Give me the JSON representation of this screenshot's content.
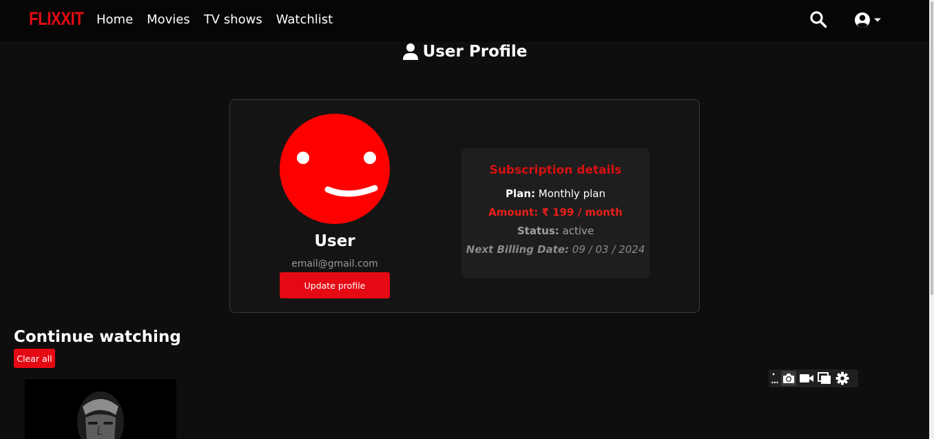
{
  "brand": {
    "name": "FLIXXIT",
    "color": "#e50914"
  },
  "nav": {
    "links": [
      "Home",
      "Movies",
      "TV shows",
      "Watchlist"
    ],
    "search_icon": "search-icon",
    "account_icon": "user-circle-icon"
  },
  "page": {
    "title": "User Profile",
    "title_icon": "user-icon"
  },
  "profile": {
    "name": "User",
    "email": "email@gmail.com",
    "update_button": "Update profile",
    "avatar_icon": "smiley-face-avatar"
  },
  "subscription": {
    "title": "Subscription details",
    "plan_label": "Plan:",
    "plan_value": "Monthly plan",
    "amount_label": "Amount:",
    "amount_value": "₹ 199 / month",
    "status_label": "Status:",
    "status_value": "active",
    "billing_label": "Next Billing Date:",
    "billing_value": "09 / 03 / 2024"
  },
  "continue_watching": {
    "title": "Continue watching",
    "clear_button": "Clear all"
  },
  "toolbar": {
    "icons": [
      "more-dots-icon",
      "camera-icon",
      "video-camera-icon",
      "window-icon",
      "gear-icon"
    ]
  },
  "colors": {
    "accent": "#e50914",
    "background": "#0e0e0e",
    "card": "#141414"
  }
}
